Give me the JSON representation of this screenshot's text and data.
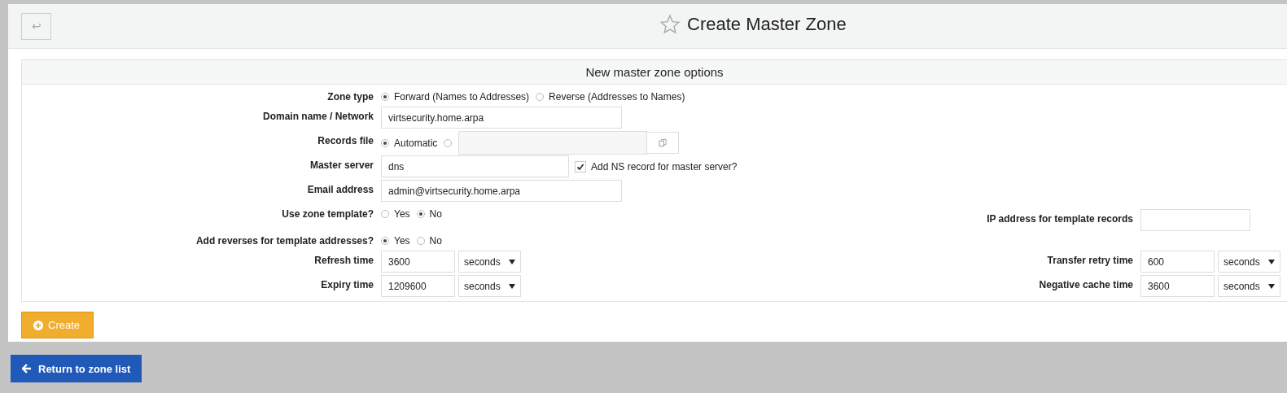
{
  "header": {
    "back_icon": "↩",
    "title": "Create Master Zone"
  },
  "panel": {
    "title": "New master zone options",
    "rows": [
      {
        "label": "Zone type",
        "kind": "radios",
        "options": [
          {
            "label": "Forward (Names to Addresses)",
            "selected": true
          },
          {
            "label": "Reverse (Addresses to Names)",
            "selected": false
          }
        ]
      },
      {
        "label": "Domain name / Network",
        "kind": "text",
        "value": "virtsecurity.home.arpa"
      },
      {
        "label": "Records file",
        "kind": "file",
        "options": [
          {
            "label": "Automatic",
            "selected": true
          },
          {
            "selected": false
          }
        ]
      },
      {
        "label": "Master server",
        "kind": "text-check",
        "value": "dns",
        "check": {
          "label": "Add NS record for master server?",
          "checked": true
        }
      },
      {
        "label": "Email address",
        "kind": "text",
        "value": "admin@virtsecurity.home.arpa"
      },
      {
        "label": "Use zone template?",
        "kind": "radios",
        "options": [
          {
            "label": "Yes",
            "selected": false
          },
          {
            "label": "No",
            "selected": true
          }
        ],
        "right": {
          "label": "IP address for template records",
          "kind": "text"
        }
      },
      {
        "label": "Add reverses for template addresses?",
        "kind": "radios",
        "options": [
          {
            "label": "Yes",
            "selected": true
          },
          {
            "label": "No",
            "selected": false
          }
        ]
      },
      {
        "label": "Refresh time",
        "kind": "number-unit",
        "value": "3600",
        "unit": "seconds",
        "right": {
          "label": "Transfer retry time",
          "kind": "number-unit",
          "value": "600",
          "unit": "seconds"
        }
      },
      {
        "label": "Expiry time",
        "kind": "number-unit",
        "value": "1209600",
        "unit": "seconds",
        "right": {
          "label": "Negative cache time",
          "kind": "number-unit",
          "value": "3600",
          "unit": "seconds"
        }
      }
    ]
  },
  "create_button": "Create",
  "return_button": "Return to zone list"
}
